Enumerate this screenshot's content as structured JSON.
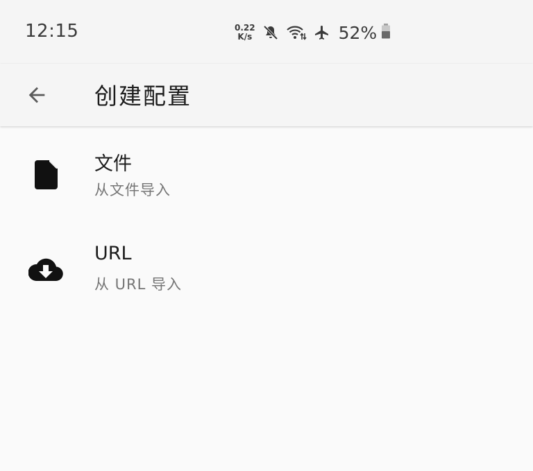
{
  "status_bar": {
    "time": "12:15",
    "net_speed_value": "0.22",
    "net_speed_unit": "K/s",
    "battery_percent": "52%",
    "icons": [
      "mute-icon",
      "wifi-icon",
      "airplane-mode-icon",
      "battery-icon"
    ]
  },
  "app_bar": {
    "title": "创建配置",
    "back_icon": "arrow-left-icon"
  },
  "items": [
    {
      "title": "文件",
      "subtitle": "从文件导入",
      "icon": "file-icon"
    },
    {
      "title": "URL",
      "subtitle": "从 URL 导入",
      "icon": "cloud-download-icon"
    }
  ],
  "colors": {
    "background": "#fafafa",
    "bar_background": "#f5f5f5",
    "primary_text": "#1c1c1c",
    "secondary_text": "#757575",
    "icon": "#111111"
  }
}
